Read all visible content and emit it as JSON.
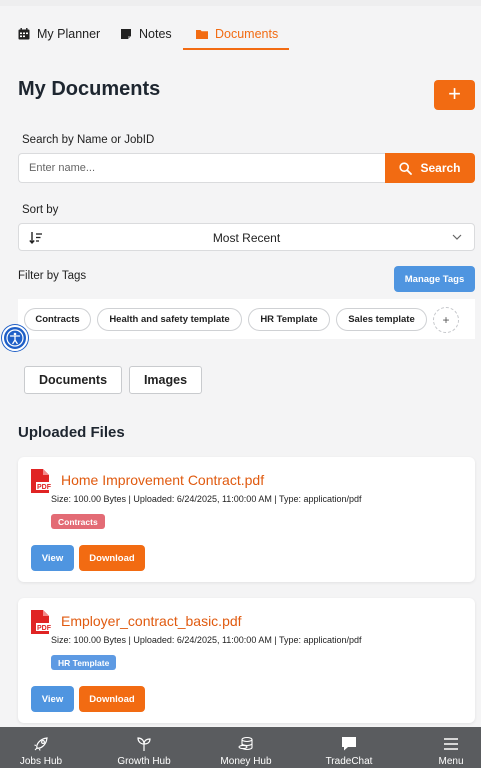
{
  "tabs": [
    {
      "label": "My Planner",
      "icon": "calendar-icon"
    },
    {
      "label": "Notes",
      "icon": "note-icon"
    },
    {
      "label": "Documents",
      "icon": "folder-icon",
      "active": true
    }
  ],
  "header": {
    "title": "My Documents",
    "add_label": "+"
  },
  "search": {
    "label": "Search by Name or JobID",
    "placeholder": "Enter name...",
    "button_label": "Search"
  },
  "sort": {
    "label": "Sort by",
    "value": "Most Recent"
  },
  "filter": {
    "label": "Filter by Tags",
    "manage_label": "Manage Tags",
    "tags": [
      "Contracts",
      "Health and safety template",
      "HR Template",
      "Sales template"
    ],
    "add_tag_label": "+"
  },
  "segments": {
    "documents": "Documents",
    "images": "Images"
  },
  "uploaded": {
    "title": "Uploaded Files",
    "files": [
      {
        "name": "Home Improvement Contract.pdf",
        "meta": "Size: 100.00 Bytes | Uploaded: 6/24/2025, 11:00:00 AM | Type: application/pdf",
        "tag": "Contracts",
        "tag_color": "#e36b75",
        "view_label": "View",
        "download_label": "Download"
      },
      {
        "name": "Employer_contract_basic.pdf",
        "meta": "Size: 100.00 Bytes | Uploaded: 6/24/2025, 11:00:00 AM | Type: application/pdf",
        "tag": "HR Template",
        "tag_color": "#5d9ae3",
        "view_label": "View",
        "download_label": "Download"
      }
    ]
  },
  "bottom_nav": [
    {
      "label": "Jobs Hub",
      "icon": "rocket-icon"
    },
    {
      "label": "Growth Hub",
      "icon": "sprout-icon"
    },
    {
      "label": "Money Hub",
      "icon": "coins-icon"
    },
    {
      "label": "TradeChat",
      "icon": "chat-icon"
    },
    {
      "label": "Menu",
      "icon": "menu-icon"
    }
  ],
  "colors": {
    "accent": "#f26b12",
    "secondary": "#4f95e0",
    "nav_bg": "#5a5c5f"
  }
}
